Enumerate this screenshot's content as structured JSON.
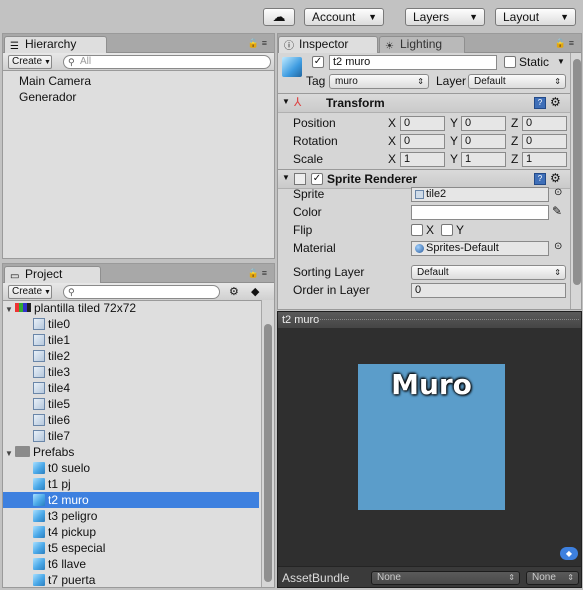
{
  "toolbar": {
    "cloud_icon": "cloud-icon",
    "account": "Account",
    "layers": "Layers",
    "layout": "Layout"
  },
  "hierarchy": {
    "tab": "Hierarchy",
    "create": "Create",
    "search_placeholder": "All",
    "items": [
      "Main Camera",
      "Generador"
    ]
  },
  "project": {
    "tab": "Project",
    "create": "Create",
    "assets": [
      {
        "label": "plantilla tiled 72x72",
        "type": "texture",
        "expanded": true,
        "children": [
          "tile0",
          "tile1",
          "tile2",
          "tile3",
          "tile4",
          "tile5",
          "tile6",
          "tile7"
        ]
      },
      {
        "label": "Prefabs",
        "type": "folder",
        "expanded": true,
        "children": [
          "t0 suelo",
          "t1 pj",
          "t2 muro",
          "t3 peligro",
          "t4 pickup",
          "t5 especial",
          "t6 llave",
          "t7 puerta"
        ]
      }
    ],
    "selected": "t2 muro"
  },
  "inspector": {
    "tab": "Inspector",
    "tab_lighting": "Lighting",
    "object_name": "t2 muro",
    "static_label": "Static",
    "tag_label": "Tag",
    "tag_value": "muro",
    "layer_label": "Layer",
    "layer_value": "Default",
    "transform": {
      "title": "Transform",
      "rows": [
        {
          "label": "Position",
          "x": "0",
          "y": "0",
          "z": "0"
        },
        {
          "label": "Rotation",
          "x": "0",
          "y": "0",
          "z": "0"
        },
        {
          "label": "Scale",
          "x": "1",
          "y": "1",
          "z": "1"
        }
      ],
      "axis": [
        "X",
        "Y",
        "Z"
      ]
    },
    "sprite_renderer": {
      "title": "Sprite Renderer",
      "sprite_label": "Sprite",
      "sprite_value": "tile2",
      "color_label": "Color",
      "flip_label": "Flip",
      "flip_x": "X",
      "flip_y": "Y",
      "material_label": "Material",
      "material_value": "Sprites-Default",
      "sorting_layer_label": "Sorting Layer",
      "sorting_layer_value": "Default",
      "order_label": "Order in Layer",
      "order_value": "0"
    }
  },
  "preview": {
    "title": "t2 muro",
    "sprite_text": "Muro",
    "sprite_color": "#5b9dca",
    "asset_bundle_label": "AssetBundle",
    "bundle_value": "None",
    "variant_value": "None"
  },
  "colors": {
    "selection": "#3d80df",
    "preview_bg": "#2f2f2f"
  }
}
